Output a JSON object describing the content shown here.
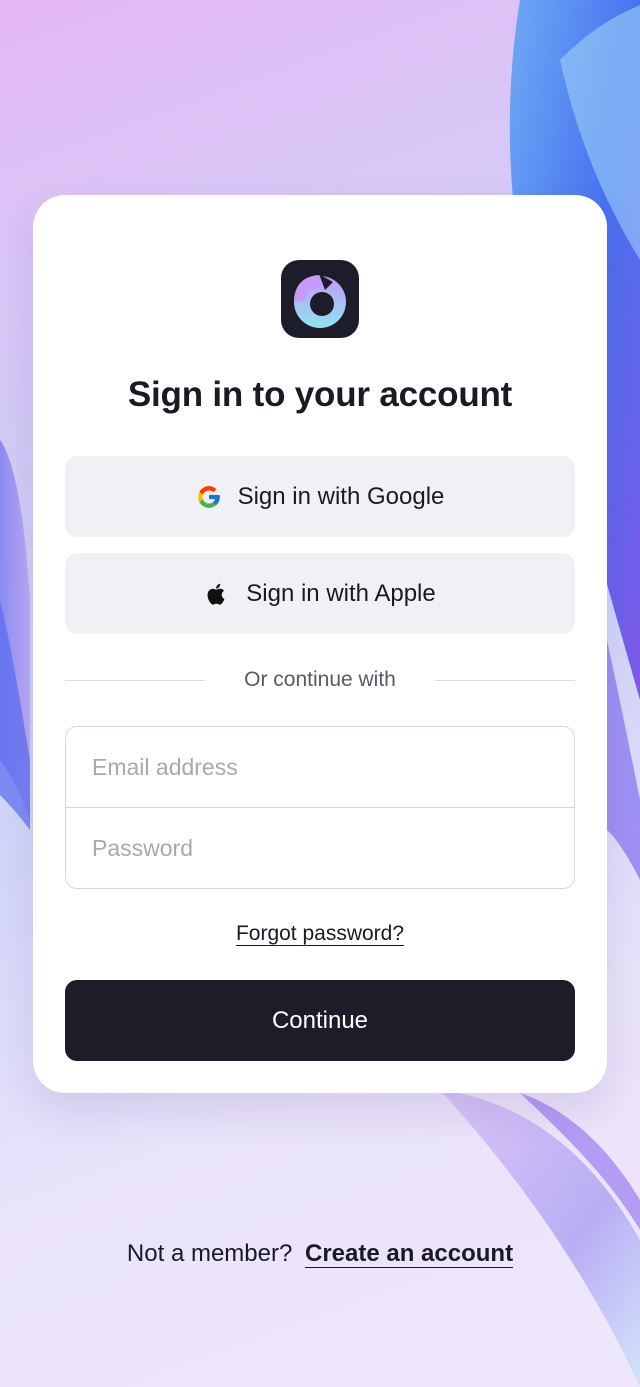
{
  "page": {
    "title": "Sign in to your account"
  },
  "oauth": {
    "google_label": "Sign in with Google",
    "apple_label": "Sign in with Apple"
  },
  "divider": {
    "text": "Or continue with"
  },
  "form": {
    "email_placeholder": "Email address",
    "email_value": "",
    "password_placeholder": "Password",
    "password_value": ""
  },
  "links": {
    "forgot_password": "Forgot password?"
  },
  "actions": {
    "continue_label": "Continue"
  },
  "footer": {
    "prompt": "Not a member?",
    "create_account": "Create an account"
  },
  "icons": {
    "logo": "app-logo-icon",
    "google": "google-icon",
    "apple": "apple-icon"
  },
  "colors": {
    "primary_button": "#1d1c28",
    "secondary_button": "#f1f1f5",
    "text": "#1b1a24",
    "muted_text": "#5a5a66",
    "placeholder": "#a8a8b2"
  }
}
